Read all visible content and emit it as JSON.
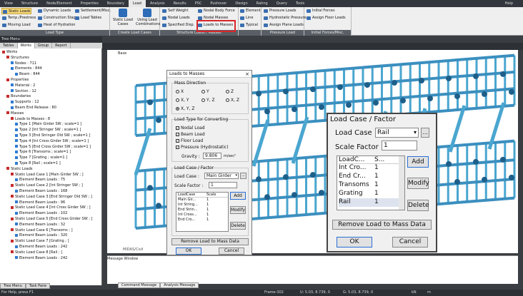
{
  "menu": {
    "tabs": [
      "View",
      "Structure",
      "Node/Element",
      "Properties",
      "Boundary",
      "Load",
      "Analysis",
      "Results",
      "PSC",
      "Pushover",
      "Design",
      "Rating",
      "Query",
      "Tools"
    ],
    "active": "Load",
    "help": "Help"
  },
  "ribbon": {
    "type_buttons": [
      "Static Loads",
      "Temp./Prestress",
      "Moving Load",
      "Dynamic Loads",
      "Construction Stage",
      "Heat of Hydration",
      "Settlement/Misc.",
      "Load Tables"
    ],
    "load_type_label": "Load Type",
    "static_load_cases": "Static Load\nCases",
    "using_load_combinations": "Using Load\nCombinations",
    "create_load_cases_label": "Create Load Cases",
    "structure_buttons": [
      "Self Weight",
      "Nodal Loads",
      "Specified Disp.",
      "Nodal Body Force",
      "Nodal Masses",
      "Loads to Masses"
    ],
    "structure_label": "Structure Loads / Masses",
    "element_buttons": [
      "Element",
      "Line",
      "Typical"
    ],
    "pressure_buttons": [
      "Pressure Loads",
      "Hydrostatic Pressure",
      "Assign Plane Loads"
    ],
    "pressure_label": "Pressure Load",
    "initial_buttons": [
      "Initial Forces",
      "Assign Floor Loads"
    ],
    "initial_label": "Initial Forces/Misc."
  },
  "tree": {
    "title": "Tree Menu",
    "tabs": [
      "Tables",
      "Works",
      "Group",
      "Report"
    ],
    "items": [
      "Works",
      "Structures",
      "Nodes : 711",
      "Elements : 844",
      "Beam : 844",
      "Properties",
      "Material : 2",
      "Section : 12",
      "Boundaries",
      "Supports : 12",
      "Beam End Release : 80",
      "Masses",
      "Loads to Masses : 8",
      "Type 1 [Main Girder SW ; scale=1 ]",
      "Type 2 [Int Stringer SW ; scale=1 ]",
      "Type 3 [End Stringer Old SW ; scale=1 ]",
      "Type 4 [Int Cross Girder SW ; scale=1 ]",
      "Type 5 [End Cross Girder SW ; scale=1 ]",
      "Type 6 [Transoms ; scale=1 ]",
      "Type 7 [Grating ; scale=1 ]",
      "Type 8 [Rail ; scale=1 ]",
      "Static Loads",
      "Static Load Case 1 [Main Girder SW ; ]",
      "Element Beam Loads : 75",
      "Static Load Case 2 [Int Stringer SW ; ]",
      "Element Beam Loads : 168",
      "Static Load Case 3 [End Stringer Old SW ; ]",
      "Element Beam Loads : 96",
      "Static Load Case 4 [Int Cross Girder SW ; ]",
      "Element Beam Loads : 102",
      "Static Load Case 5 [End Cross Girder SW ; ]",
      "Element Beam Loads : 32",
      "Static Load Case 6 [Transoms ; ]",
      "Element Beam Loads : 320",
      "Static Load Case 7 [Grating ; ]",
      "Element Beam Loads : 242",
      "Static Load Case 8 [Rail ; ]",
      "Element Beam Loads : 242"
    ]
  },
  "view": {
    "tab": "Base",
    "logo": "MIDAS/Civil"
  },
  "dialog_small": {
    "title": "Loads to Masses",
    "mass_direction": "Mass Direction",
    "dirs": [
      "X",
      "Y",
      "Z",
      "X, Y",
      "Y, Z",
      "X, Z",
      "X, Y, Z"
    ],
    "load_type_title": "Load Type for Converting",
    "load_types": [
      "Nodal Load",
      "Beam Load",
      "Floor Load",
      "Pressure (Hydrostatic)"
    ],
    "gravity_label": "Gravity :",
    "gravity_value": "9.806",
    "gravity_unit": "m/sec²",
    "lcf_title": "Load Case / Factor",
    "load_case_label": "Load Case :",
    "load_case_value": "Main Girder",
    "scale_label": "Scale Factor :",
    "scale_value": "1",
    "cols": [
      "LoadCase",
      "Scale"
    ],
    "rows": [
      [
        "Main Gir...",
        "1"
      ],
      [
        "Int String...",
        "1"
      ],
      [
        "End Strin...",
        "1"
      ],
      [
        "Int Cross...",
        "1"
      ],
      [
        "End Cro...",
        "1"
      ]
    ],
    "add": "Add",
    "modify": "Modify",
    "delete": "Delete",
    "remove": "Remove Load to Mass Data",
    "ok": "OK",
    "cancel": "Cancel"
  },
  "dialog_large": {
    "title": "Load Case / Factor",
    "load_case_label": "Load Case :",
    "load_case_value": "Rail",
    "scale_label": "Scale Factor",
    "scale_value": "1",
    "cols": [
      "LoadC...",
      "S..."
    ],
    "rows": [
      [
        "Int Cro...",
        "1"
      ],
      [
        "End Cr...",
        "1"
      ],
      [
        "Transoms",
        "1"
      ],
      [
        "Grating",
        "1"
      ],
      [
        "Rail",
        "1"
      ]
    ],
    "add": "Add",
    "modify": "Modify",
    "delete": "Delete",
    "remove": "Remove Load to Mass Data",
    "ok": "OK",
    "cancel": "Cancel"
  },
  "message": {
    "title": "Message Window",
    "tabs": [
      "Command Message",
      "Analysis Message"
    ]
  },
  "bottom_tabs": [
    "Tree Menu",
    "Task Pane"
  ],
  "status": {
    "help": "For Help, press F1",
    "frame": "Frame-302",
    "u": "U: 5.03, 8.739, 0",
    "g": "G: 5.03, 8.739, 0",
    "unit": "kN",
    "len": "m"
  },
  "colors": {
    "accent": "#d9262a",
    "truss": "#4aa6d0"
  }
}
